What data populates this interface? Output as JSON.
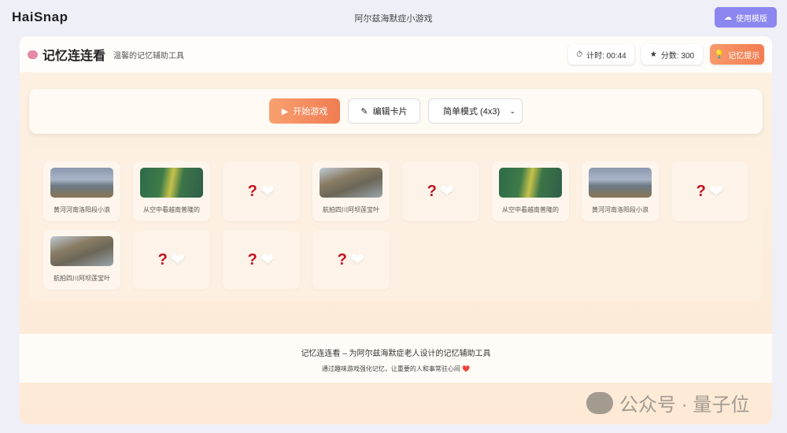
{
  "topbar": {
    "logo": "HaiSnap",
    "title": "阿尔兹海默症小游戏",
    "template_button": "使用模版"
  },
  "header": {
    "title": "记忆连连看",
    "subtitle": "温馨的记忆辅助工具",
    "timer": "计时: 00:44",
    "score": "分数: 300",
    "hint_button": "记忆提示"
  },
  "controls": {
    "start": "开始游戏",
    "edit": "编辑卡片",
    "mode": "简单模式 (4x3)"
  },
  "cards": [
    {
      "state": "up",
      "image": "lake",
      "label": "黄河河南洛阳段小浪"
    },
    {
      "state": "up",
      "image": "valley",
      "label": "从空中看越南普隆的"
    },
    {
      "state": "down",
      "q": "?",
      "heart": "❤"
    },
    {
      "state": "up",
      "image": "mtn",
      "label": "航拍四川阿坝莲宝叶"
    },
    {
      "state": "down",
      "q": "?",
      "heart": "❤"
    },
    {
      "state": "up",
      "image": "valley",
      "label": "从空中看越南普隆的"
    },
    {
      "state": "up",
      "image": "lake",
      "label": "黄河河南洛阳段小浪"
    },
    {
      "state": "down",
      "q": "?",
      "heart": "❤"
    },
    {
      "state": "up",
      "image": "mtn",
      "label": "航拍四川阿坝莲宝叶"
    },
    {
      "state": "down",
      "q": "?",
      "heart": "❤"
    },
    {
      "state": "down",
      "q": "?",
      "heart": "❤"
    },
    {
      "state": "down",
      "q": "?",
      "heart": "❤"
    }
  ],
  "footer": {
    "line1": "记忆连连看 – 为阿尔兹海默症老人设计的记忆辅助工具",
    "line2": "通过趣味游戏强化记忆，让重要的人和事常驻心间",
    "heart": "❤️"
  },
  "watermark": "公众号 · 量子位"
}
